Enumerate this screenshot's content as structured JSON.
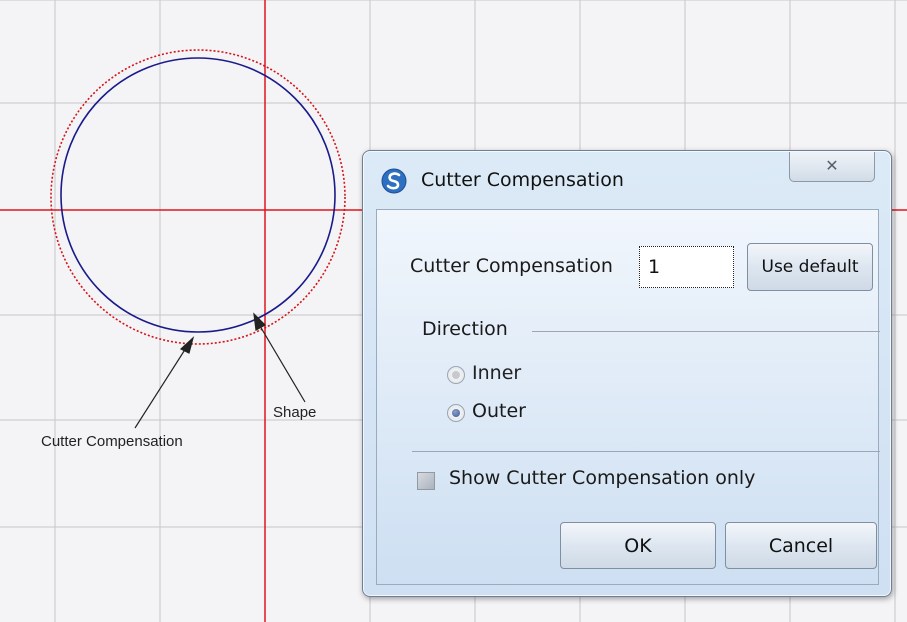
{
  "annotations": {
    "cutter_compensation": "Cutter Compensation",
    "shape": "Shape"
  },
  "dialog": {
    "title": "Cutter Compensation",
    "close_glyph": "✕",
    "compensation_label": "Cutter Compensation",
    "compensation_value": "1",
    "use_default_label": "Use default",
    "direction_label": "Direction",
    "direction_options": [
      {
        "label": "Inner",
        "checked": false,
        "enabled": false
      },
      {
        "label": "Outer",
        "checked": true,
        "enabled": true
      }
    ],
    "show_only_label": "Show Cutter Compensation only",
    "show_only_checked": false,
    "ok_label": "OK",
    "cancel_label": "Cancel"
  },
  "colors": {
    "grid": "#c6c6c8",
    "axis": "#e0141e",
    "shape": "#1a1a8a",
    "compensation_path": "#d4141a",
    "dialog_bg": "#d6e5f5"
  }
}
